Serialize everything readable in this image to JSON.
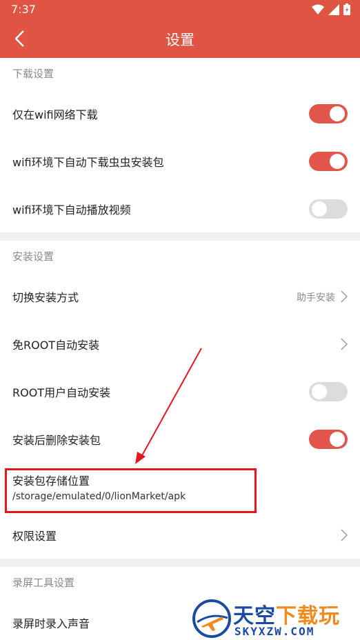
{
  "status_bar": {
    "time": "7:37"
  },
  "app_bar": {
    "title": "设置"
  },
  "sections": {
    "download": {
      "header": "下载设置",
      "items": [
        {
          "label": "仅在wifi网络下载",
          "toggle": "on"
        },
        {
          "label": "wifi环境下自动下载虫虫安装包",
          "toggle": "on"
        },
        {
          "label": "wifi环境下自动播放视频",
          "toggle": "off"
        }
      ]
    },
    "install": {
      "header": "安装设置",
      "switch_method": {
        "label": "切换安装方式",
        "value": "助手安装"
      },
      "no_root": {
        "label": "免ROOT自动安装"
      },
      "root_auto": {
        "label": "ROOT用户自动安装",
        "toggle": "off"
      },
      "delete_after": {
        "label": "安装后删除安装包",
        "toggle": "on"
      },
      "storage": {
        "label": "安装包存储位置",
        "path": "/storage/emulated/0/lionMarket/apk"
      },
      "permissions": {
        "label": "权限设置"
      }
    },
    "recorder": {
      "header": "录屏工具设置",
      "record_audio": {
        "label": "录屏时录入声音"
      }
    }
  },
  "watermark": {
    "line1_a": "天空",
    "line1_b": "下载玩",
    "line2": "SKYXZW.COM"
  },
  "colors": {
    "accent": "#df5443",
    "toggle_on": "#e2554a",
    "highlight": "#e8141e"
  }
}
